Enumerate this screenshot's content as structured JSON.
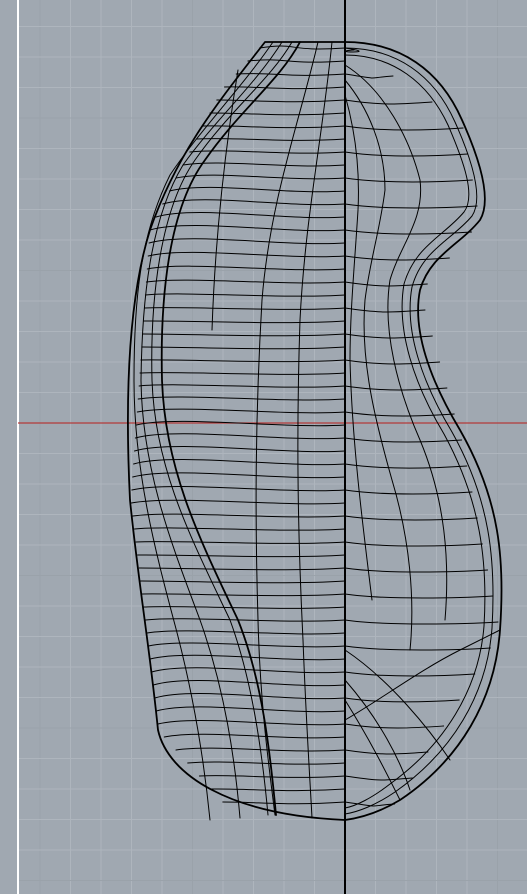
{
  "viewport": {
    "colors": {
      "background": "#a0a8b1",
      "grid_minor": "#aeb5bd",
      "grid_major": "#9aa2aa",
      "axis_x": "#b43a3a",
      "axis_y": "#000000",
      "border_left": "#ffffff",
      "wireframe": "#000000"
    }
  }
}
